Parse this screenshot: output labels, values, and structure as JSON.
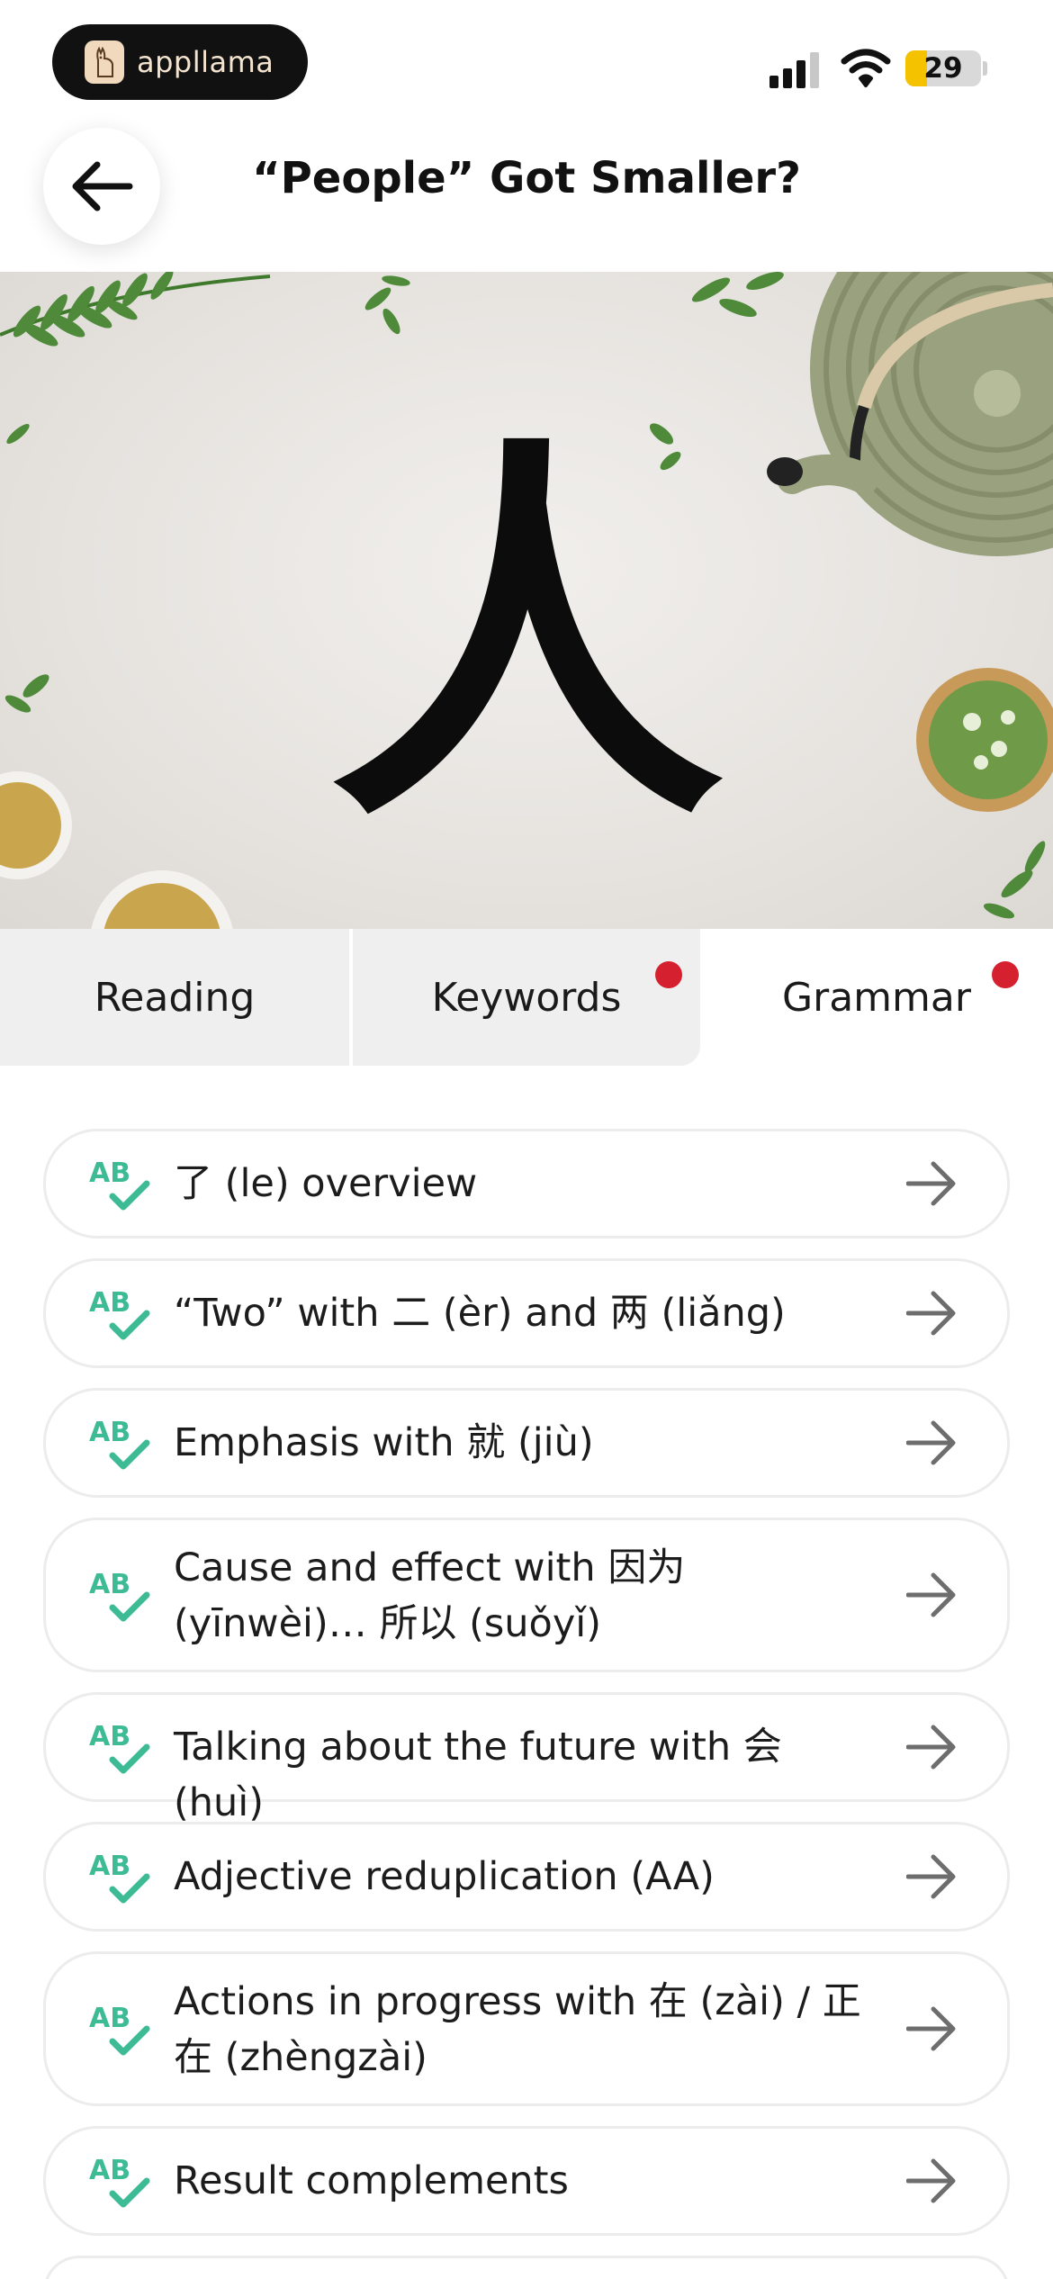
{
  "status_bar": {
    "app_name": "appllama",
    "battery_level": "29",
    "battery_color": "#f5c200"
  },
  "header": {
    "title": "“People” Got Smaller?",
    "back_icon": "arrow-left-icon"
  },
  "hero": {
    "character": "人"
  },
  "tabs": [
    {
      "label": "Reading",
      "active": false,
      "has_dot": false
    },
    {
      "label": "Keywords",
      "active": false,
      "has_dot": true
    },
    {
      "label": "Grammar",
      "active": true,
      "has_dot": true
    }
  ],
  "grammar_items": [
    {
      "label": "了 (le) overview"
    },
    {
      "label": "“Two” with 二 (èr) and 两 (liǎng)"
    },
    {
      "label": "Emphasis with 就 (jiù)"
    },
    {
      "label": "Cause and effect with 因为 (yīnwèi)… 所以 (suǒyǐ)"
    },
    {
      "label": "Talking about the future with 会 (huì)"
    },
    {
      "label": "Adjective reduplication (AA)"
    },
    {
      "label": "Actions in progress with 在 (zài) / 正在 (zhèngzài)"
    },
    {
      "label": "Result complements"
    }
  ],
  "colors": {
    "accent_green": "#3dbb94",
    "notification_red": "#d4202f",
    "tab_inactive_bg": "#efefef"
  }
}
